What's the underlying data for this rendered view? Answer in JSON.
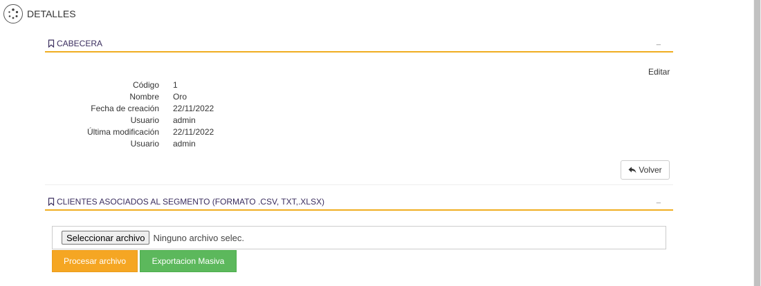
{
  "header": {
    "title": "DETALLES",
    "icon": "spinner-logo-icon"
  },
  "cabecera": {
    "title": "CABECERA",
    "collapse_label": "_",
    "edit_label": "Editar",
    "fields": [
      {
        "label": "Código",
        "value": "1"
      },
      {
        "label": "Nombre",
        "value": "Oro"
      },
      {
        "label": "Fecha de creación",
        "value": "22/11/2022"
      },
      {
        "label": "Usuario",
        "value": "admin"
      },
      {
        "label": "Última modificación",
        "value": "22/11/2022"
      },
      {
        "label": "Usuario",
        "value": "admin"
      }
    ],
    "back_label": "Volver"
  },
  "clientes": {
    "title": "CLIENTES ASOCIADOS AL SEGMENTO (FORMATO .CSV, TXT,.XLSX)",
    "collapse_label": "_",
    "file_button_label": "Seleccionar archivo",
    "file_status": "Ninguno archivo selec.",
    "process_label": "Procesar archivo",
    "export_label": "Exportacion Masiva"
  },
  "colors": {
    "accent": "#f0ad1f",
    "process": "#f5a623",
    "export": "#5cb85c",
    "title_text": "#3a2d5e"
  }
}
